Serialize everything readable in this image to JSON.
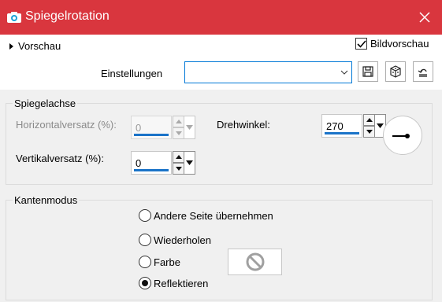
{
  "window": {
    "title": "Spiegelrotation",
    "title_bar_color": "#d9363e",
    "app_icon": "camera-icon",
    "close_icon": "close-icon"
  },
  "preview": {
    "toggle_label": "Vorschau",
    "bildvorschau_label": "Bildvorschau",
    "bildvorschau_checked": true
  },
  "settings": {
    "label": "Einstellungen",
    "value": "",
    "buttons": [
      "save-icon",
      "random-dice-icon",
      "reset-icon"
    ]
  },
  "spiegelachse": {
    "legend": "Spiegelachse",
    "horizontal": {
      "label": "Horizontalversatz (%):",
      "value": "0",
      "enabled": false
    },
    "vertical": {
      "label": "Vertikalversatz (%):",
      "value": "0",
      "enabled": true
    },
    "rotation": {
      "label": "Drehwinkel:",
      "value": "270"
    }
  },
  "kantenmodus": {
    "legend": "Kantenmodus",
    "options": [
      {
        "label": "Andere Seite übernehmen",
        "selected": false
      },
      {
        "label": "Wiederholen",
        "selected": false
      },
      {
        "label": "Farbe",
        "selected": false
      },
      {
        "label": "Reflektieren",
        "selected": true
      }
    ],
    "color_swatch_icon": "no-symbol-icon"
  }
}
